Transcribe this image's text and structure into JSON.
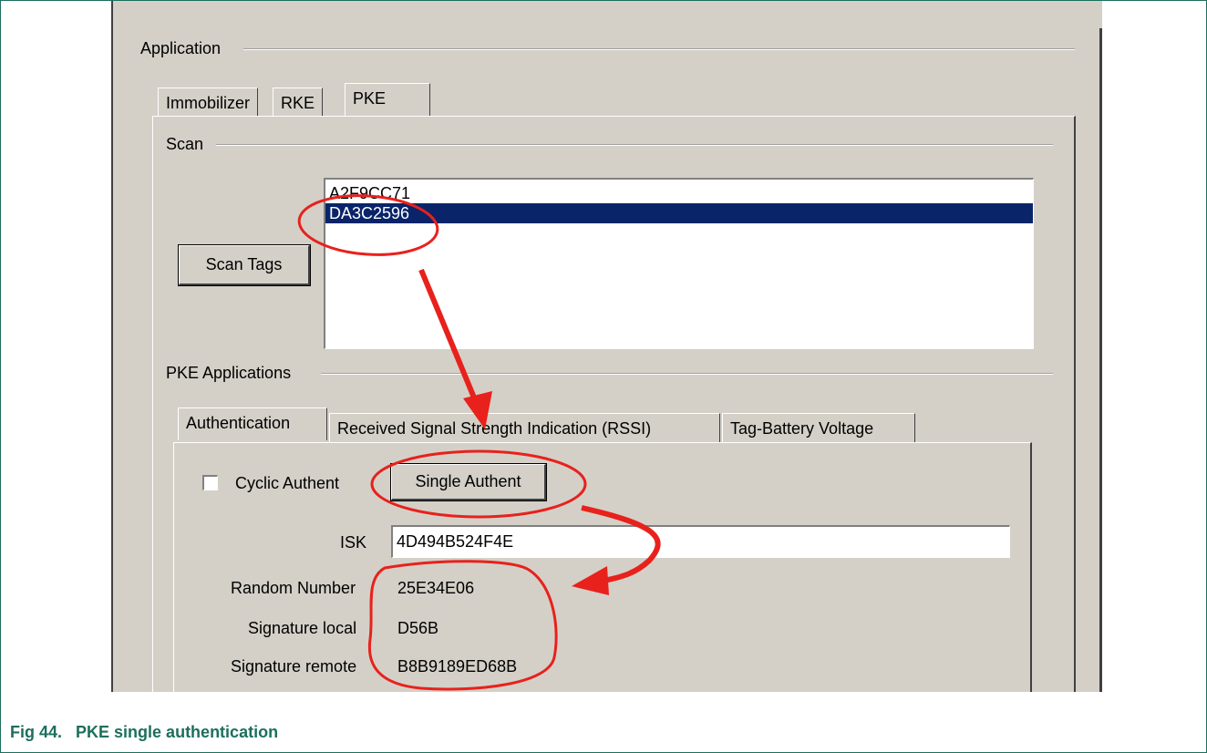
{
  "application": {
    "group_label": "Application",
    "tabs": [
      {
        "label": "Immobilizer"
      },
      {
        "label": "RKE"
      },
      {
        "label": "PKE"
      }
    ],
    "active_tab": "PKE"
  },
  "scan": {
    "group_label": "Scan",
    "scan_button_label": "Scan Tags",
    "tags": [
      "A2F9CC71",
      "DA3C2596"
    ],
    "selected_tag": "DA3C2596"
  },
  "pke_applications": {
    "group_label": "PKE Applications",
    "tabs": [
      {
        "label": "Authentication"
      },
      {
        "label": "Received Signal Strength Indication (RSSI)"
      },
      {
        "label": "Tag-Battery Voltage"
      }
    ],
    "active_tab": "Authentication"
  },
  "authentication": {
    "cyclic_label": "Cyclic Authent",
    "cyclic_checked": false,
    "single_button_label": "Single Authent",
    "isk_label": "ISK",
    "isk_value": "4D494B524F4E",
    "random_number_label": "Random Number",
    "random_number_value": "25E34E06",
    "signature_local_label": "Signature local",
    "signature_local_value": "D56B",
    "signature_remote_label": "Signature remote",
    "signature_remote_value": "B8B9189ED68B"
  },
  "colors": {
    "window_bg": "#d4d0c8",
    "selection_bg": "#0a246a",
    "annotation_red": "#e8211c",
    "caption_green": "#1c6f5d"
  },
  "caption": {
    "number": "Fig 44.",
    "text": "PKE single authentication"
  }
}
